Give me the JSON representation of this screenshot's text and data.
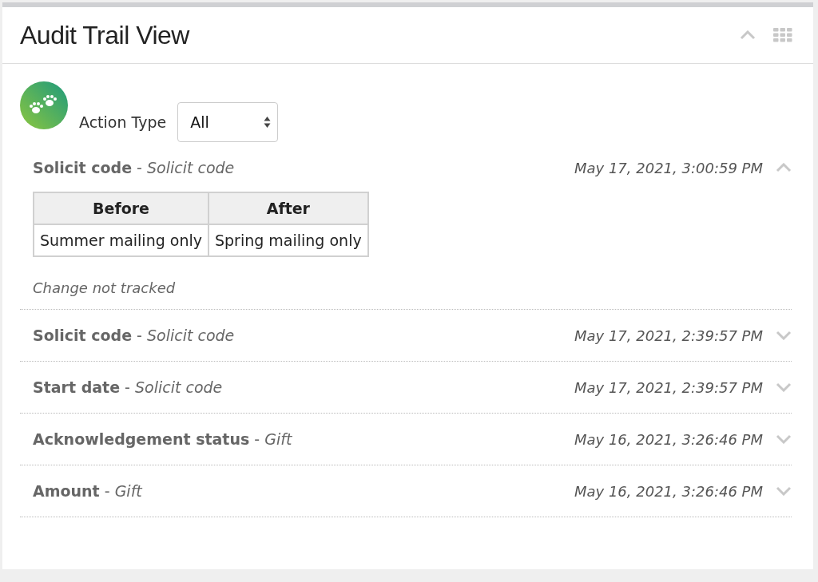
{
  "panel": {
    "title": "Audit Trail View",
    "collapsed": false
  },
  "filter": {
    "label": "Action Type",
    "value": "All"
  },
  "entries": [
    {
      "title": "**Solicit code** - *Solicit code*",
      "timestamp": "May 17, 2021, 3:00:59 PM",
      "expanded": true,
      "changes": {
        "columns": [
          "Before",
          "After"
        ],
        "rows": [
          [
            "Summer mailing only",
            "Spring mailing only"
          ]
        ]
      },
      "note": "Change not tracked"
    },
    {
      "title": "**Solicit code** - *Solicit code*",
      "timestamp": "May 17, 2021, 2:39:57 PM",
      "expanded": false
    },
    {
      "title": "**Start date** - *Solicit code*",
      "timestamp": "May 17, 2021, 2:39:57 PM",
      "expanded": false
    },
    {
      "title": "**Acknowledgement status** - *Gift*",
      "timestamp": "May 16, 2021, 3:26:46 PM",
      "expanded": false
    },
    {
      "title": "**Amount** - *Gift*",
      "timestamp": "May 16, 2021, 3:26:46 PM",
      "expanded": false
    }
  ]
}
